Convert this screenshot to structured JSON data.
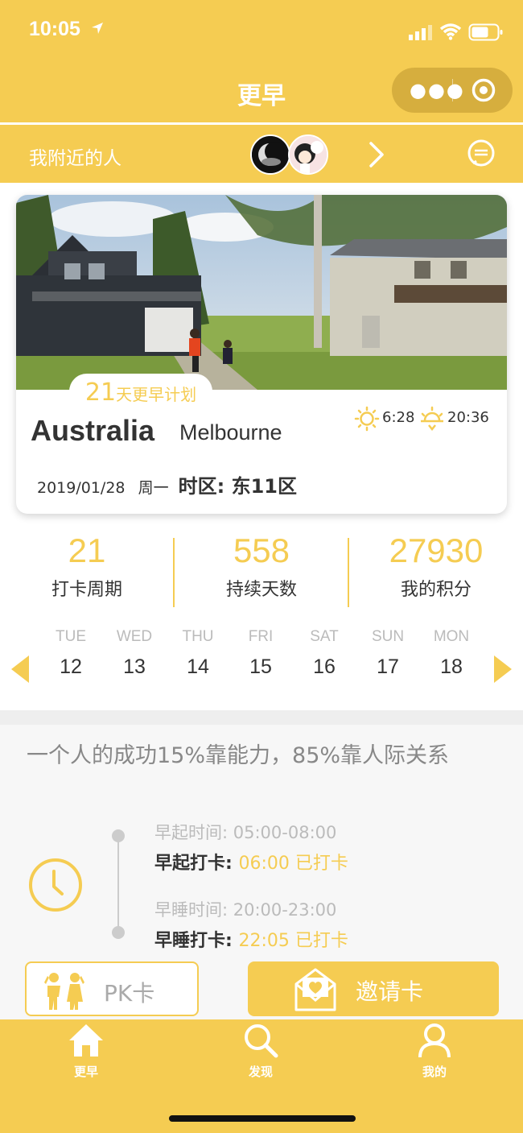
{
  "status_bar": {
    "time": "10:05"
  },
  "nav": {
    "title": "更早"
  },
  "nearby": {
    "label": "我附近的人"
  },
  "card": {
    "plan_days": "21",
    "plan_text": "天更早计划",
    "country": "Australia",
    "city": "Melbourne",
    "sunrise": "6:28",
    "sunset": "20:36",
    "date": "2019/01/28",
    "weekday": "周一",
    "timezone": "时区: 东11区"
  },
  "stats": [
    {
      "value": "21",
      "label": "打卡周期"
    },
    {
      "value": "558",
      "label": "持续天数"
    },
    {
      "value": "27930",
      "label": "我的积分"
    }
  ],
  "week": [
    {
      "name": "TUE",
      "date": "12"
    },
    {
      "name": "WED",
      "date": "13"
    },
    {
      "name": "THU",
      "date": "14"
    },
    {
      "name": "FRI",
      "date": "15"
    },
    {
      "name": "SAT",
      "date": "16"
    },
    {
      "name": "SUN",
      "date": "17"
    },
    {
      "name": "MON",
      "date": "18"
    }
  ],
  "quote": "一个人的成功15%靠能力，85%靠人际关系",
  "schedule": {
    "wake_range": "早起时间: 05:00-08:00",
    "wake_label": "早起打卡:",
    "wake_status": "06:00 已打卡",
    "sleep_range": "早睡时间: 20:00-23:00",
    "sleep_label": "早睡打卡:",
    "sleep_status": "22:05 已打卡"
  },
  "buttons": {
    "pk": "PK卡",
    "invite": "邀请卡"
  },
  "tabs": [
    {
      "label": "更早",
      "icon": "home-icon"
    },
    {
      "label": "发现",
      "icon": "search-icon"
    },
    {
      "label": "我的",
      "icon": "user-icon"
    }
  ],
  "colors": {
    "accent": "#F5CC52",
    "accent_dark": "#D6AE3E"
  }
}
